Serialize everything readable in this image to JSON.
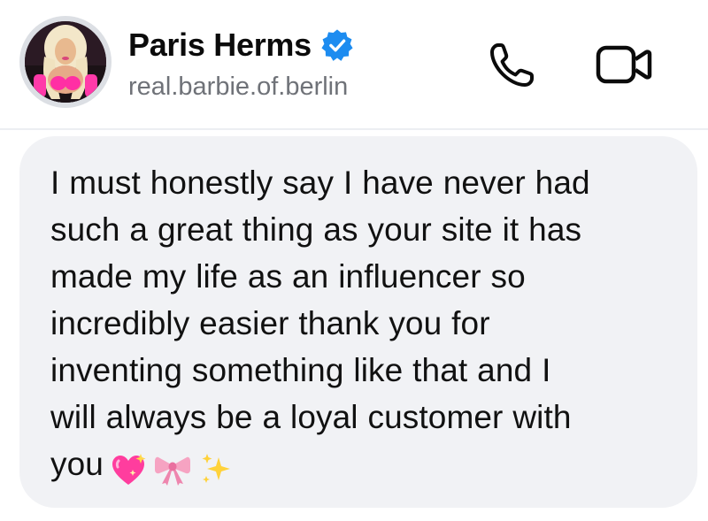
{
  "contact": {
    "name": "Paris Herms",
    "handle": "real.barbie.of.berlin",
    "verified": true,
    "verified_color": "#1d8cf0",
    "avatar_icon": "profile-photo"
  },
  "header": {
    "actions": [
      {
        "name": "call",
        "icon": "phone-icon"
      },
      {
        "name": "video",
        "icon": "video-camera-icon"
      }
    ]
  },
  "message": {
    "lines": [
      "I must honestly say I have never had",
      "such a great thing as your site it has",
      "made my life as an influencer so",
      "incredibly easier thank you for",
      "inventing something like that and I",
      "will always be a loyal customer with",
      "you"
    ],
    "emojis": [
      "sparkling-heart",
      "pink-ribbon",
      "sparkles"
    ],
    "bubble_color": "#f1f2f5"
  }
}
